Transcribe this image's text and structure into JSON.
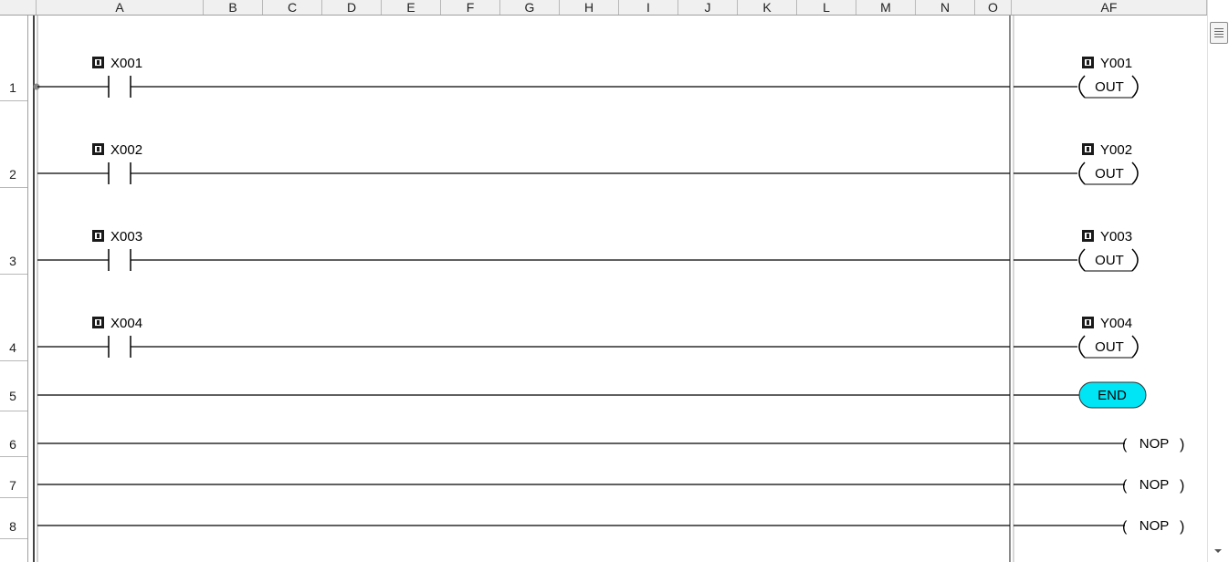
{
  "columns": [
    "A",
    "B",
    "C",
    "D",
    "E",
    "F",
    "G",
    "H",
    "I",
    "J",
    "K",
    "L",
    "M",
    "N",
    "O",
    "AF"
  ],
  "rows": [
    "1",
    "2",
    "3",
    "4",
    "5",
    "6",
    "7",
    "8"
  ],
  "rungs": [
    {
      "row": "1",
      "contact": "X001",
      "coil": "Y001",
      "instruction": "OUT"
    },
    {
      "row": "2",
      "contact": "X002",
      "coil": "Y002",
      "instruction": "OUT"
    },
    {
      "row": "3",
      "contact": "X003",
      "coil": "Y003",
      "instruction": "OUT"
    },
    {
      "row": "4",
      "contact": "X004",
      "coil": "Y004",
      "instruction": "OUT"
    }
  ],
  "end_rung": {
    "row": "5",
    "label": "END"
  },
  "nop_rungs": [
    {
      "row": "6",
      "label": "NOP"
    },
    {
      "row": "7",
      "label": "NOP"
    },
    {
      "row": "8",
      "label": "NOP"
    }
  ],
  "colors": {
    "end_fill": "#00e5f5",
    "rail": "#444444",
    "wire": "#000000",
    "header_bg": "#f0f0f0"
  },
  "icons": {
    "device": "device-tag-icon",
    "scroll_thumb": "scroll-thumb-grip-icon",
    "scroll_down": "triangle-down-icon"
  }
}
